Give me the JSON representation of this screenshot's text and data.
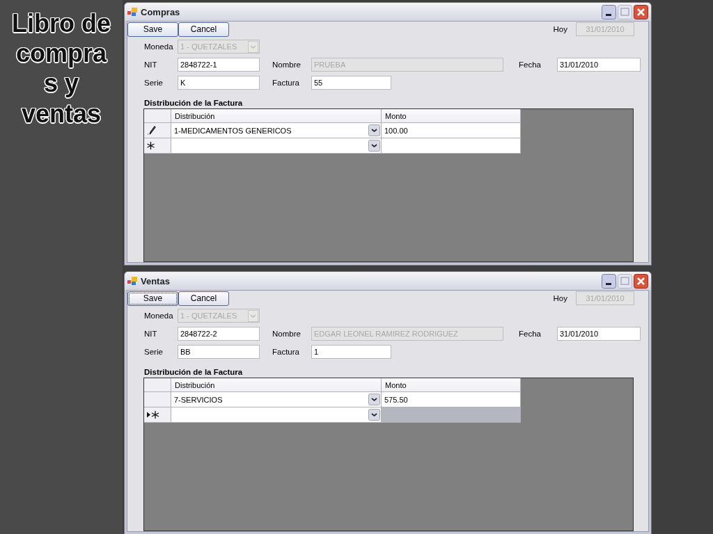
{
  "slide_title": "Libro de compras y ventas",
  "windows": [
    {
      "title": "Compras",
      "buttons": [
        {
          "label": "Save",
          "focused": false
        },
        {
          "label": "Cancel",
          "focused": false
        }
      ],
      "hoy": {
        "label": "Hoy",
        "value": "31/01/2010",
        "disabled": true
      },
      "moneda": {
        "label": "Moneda",
        "value": "1 - QUETZALES",
        "disabled": true
      },
      "nit": {
        "label": "NIT",
        "value": "2848722-1",
        "disabled": false
      },
      "nombre": {
        "label": "Nombre",
        "value": "PRUEBA",
        "disabled": true
      },
      "fecha": {
        "label": "Fecha",
        "value": "31/01/2010",
        "disabled": false
      },
      "serie": {
        "label": "Serie",
        "value": "K",
        "disabled": false
      },
      "factura": {
        "label": "Factura",
        "value": "55",
        "disabled": false
      },
      "grid": {
        "title": "Distribución de la Factura",
        "columns": [
          "Distribución",
          "Monto"
        ],
        "rows": [
          {
            "kind": "editing",
            "distribucion": "1-MEDICAMENTOS GENERICOS",
            "monto": "100.00"
          },
          {
            "kind": "new"
          }
        ]
      }
    },
    {
      "title": "Ventas",
      "buttons": [
        {
          "label": "Save",
          "focused": true
        },
        {
          "label": "Cancel",
          "focused": false
        }
      ],
      "hoy": {
        "label": "Hoy",
        "value": "31/01/2010",
        "disabled": true
      },
      "moneda": {
        "label": "Moneda",
        "value": "1 - QUETZALES",
        "disabled": true
      },
      "nit": {
        "label": "NIT",
        "value": "2848722-2",
        "disabled": false
      },
      "nombre": {
        "label": "Nombre",
        "value": "EDGAR LEONEL RAMIREZ RODRIGUEZ",
        "disabled": true
      },
      "fecha": {
        "label": "Fecha",
        "value": "31/01/2010",
        "disabled": false
      },
      "serie": {
        "label": "Serie",
        "value": "BB",
        "disabled": false
      },
      "factura": {
        "label": "Factura",
        "value": "1",
        "disabled": false
      },
      "grid": {
        "title": "Distribución de la Factura",
        "columns": [
          "Distribución",
          "Monto"
        ],
        "rows": [
          {
            "kind": "plain",
            "distribucion": "7-SERVICIOS",
            "monto": "575.50"
          },
          {
            "kind": "current-new"
          }
        ]
      }
    }
  ]
}
